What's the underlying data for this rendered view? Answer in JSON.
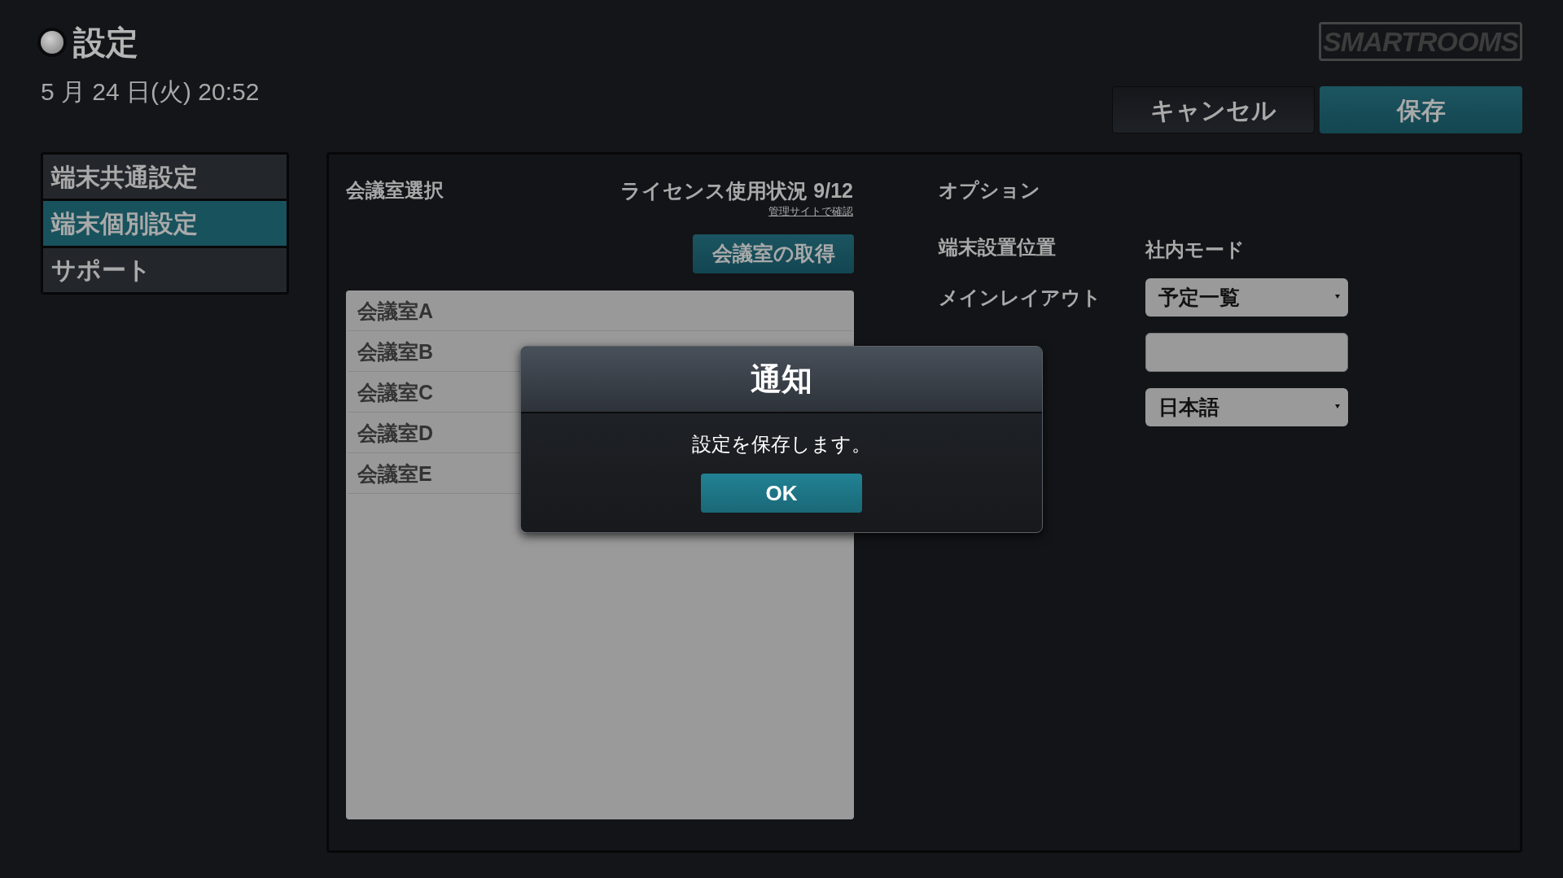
{
  "header": {
    "title": "設定",
    "datetime": "5 月 24 日(火) 20:52",
    "logo": "SMARTROOMS"
  },
  "actions": [
    {
      "label": "キャンセル",
      "kind": "secondary"
    },
    {
      "label": "保存",
      "kind": "primary"
    }
  ],
  "sidebar": {
    "items": [
      {
        "label": "端末共通設定",
        "selected": false
      },
      {
        "label": "端末個別設定",
        "selected": true
      },
      {
        "label": "サポート",
        "selected": false
      }
    ]
  },
  "rooms": {
    "heading": "会議室選択",
    "license": "ライセンス使用状況 9/12",
    "license_link": "管理サイトで確認",
    "fetch_button": "会議室の取得",
    "items": [
      {
        "label": "会議室A"
      },
      {
        "label": "会議室B"
      },
      {
        "label": "会議室C"
      },
      {
        "label": "会議室D"
      },
      {
        "label": "会議室E"
      }
    ]
  },
  "options": {
    "heading": "オプション",
    "rows": [
      {
        "kind": "text",
        "label": "端末設置位置",
        "value": "社内モード"
      },
      {
        "kind": "select",
        "label": "メインレイアウト",
        "value": "予定一覧"
      },
      {
        "kind": "input"
      },
      {
        "kind": "select",
        "value": "日本語"
      }
    ]
  },
  "dialog": {
    "title": "通知",
    "message": "設定を保存します。",
    "button": "OK"
  }
}
